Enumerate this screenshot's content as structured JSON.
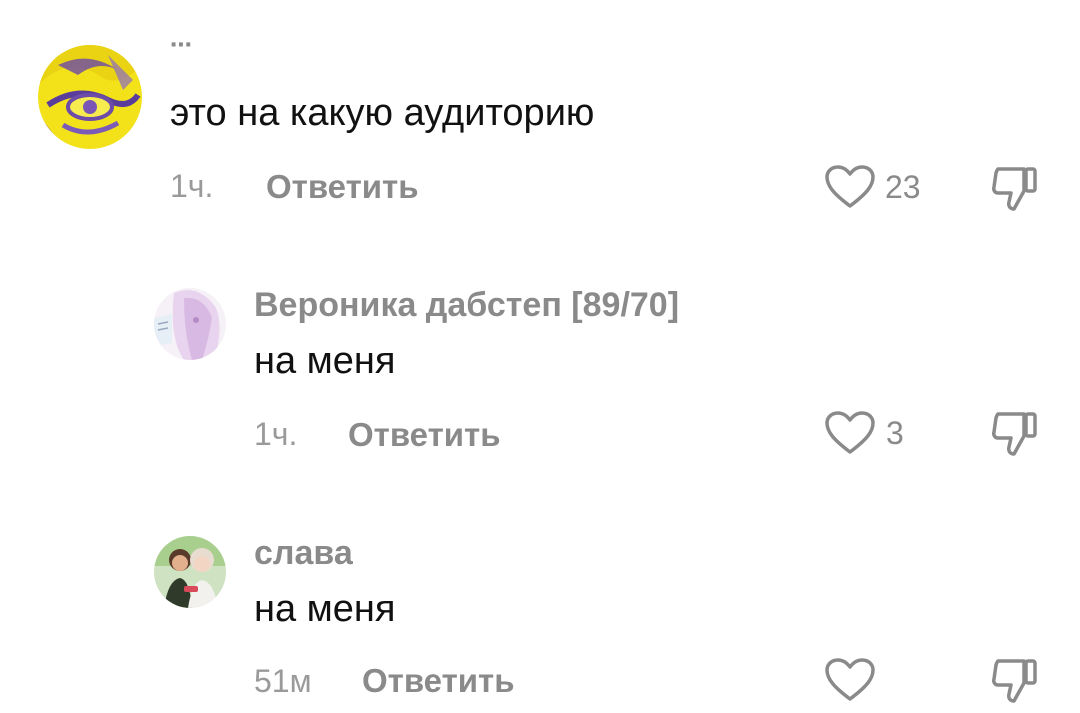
{
  "colors": {
    "username": "#8a8a8a",
    "text": "#111111",
    "meta": "#9a9a9a",
    "icon": "#8a8a8a"
  },
  "comments": [
    {
      "username": "⋯",
      "text": "это на какую аудиторию",
      "time": "1ч.",
      "reply_label": "Ответить",
      "likes": "23",
      "avatar_icon": "yellow-anime-avatar"
    },
    {
      "username": "Вероника дабстеп [89/70]",
      "text": "на меня",
      "time": "1ч.",
      "reply_label": "Ответить",
      "likes": "3",
      "avatar_icon": "pink-anime-avatar"
    },
    {
      "username": "слава",
      "text": "на меня",
      "time": "51м",
      "reply_label": "Ответить",
      "likes": "",
      "avatar_icon": "two-characters-avatar"
    }
  ]
}
